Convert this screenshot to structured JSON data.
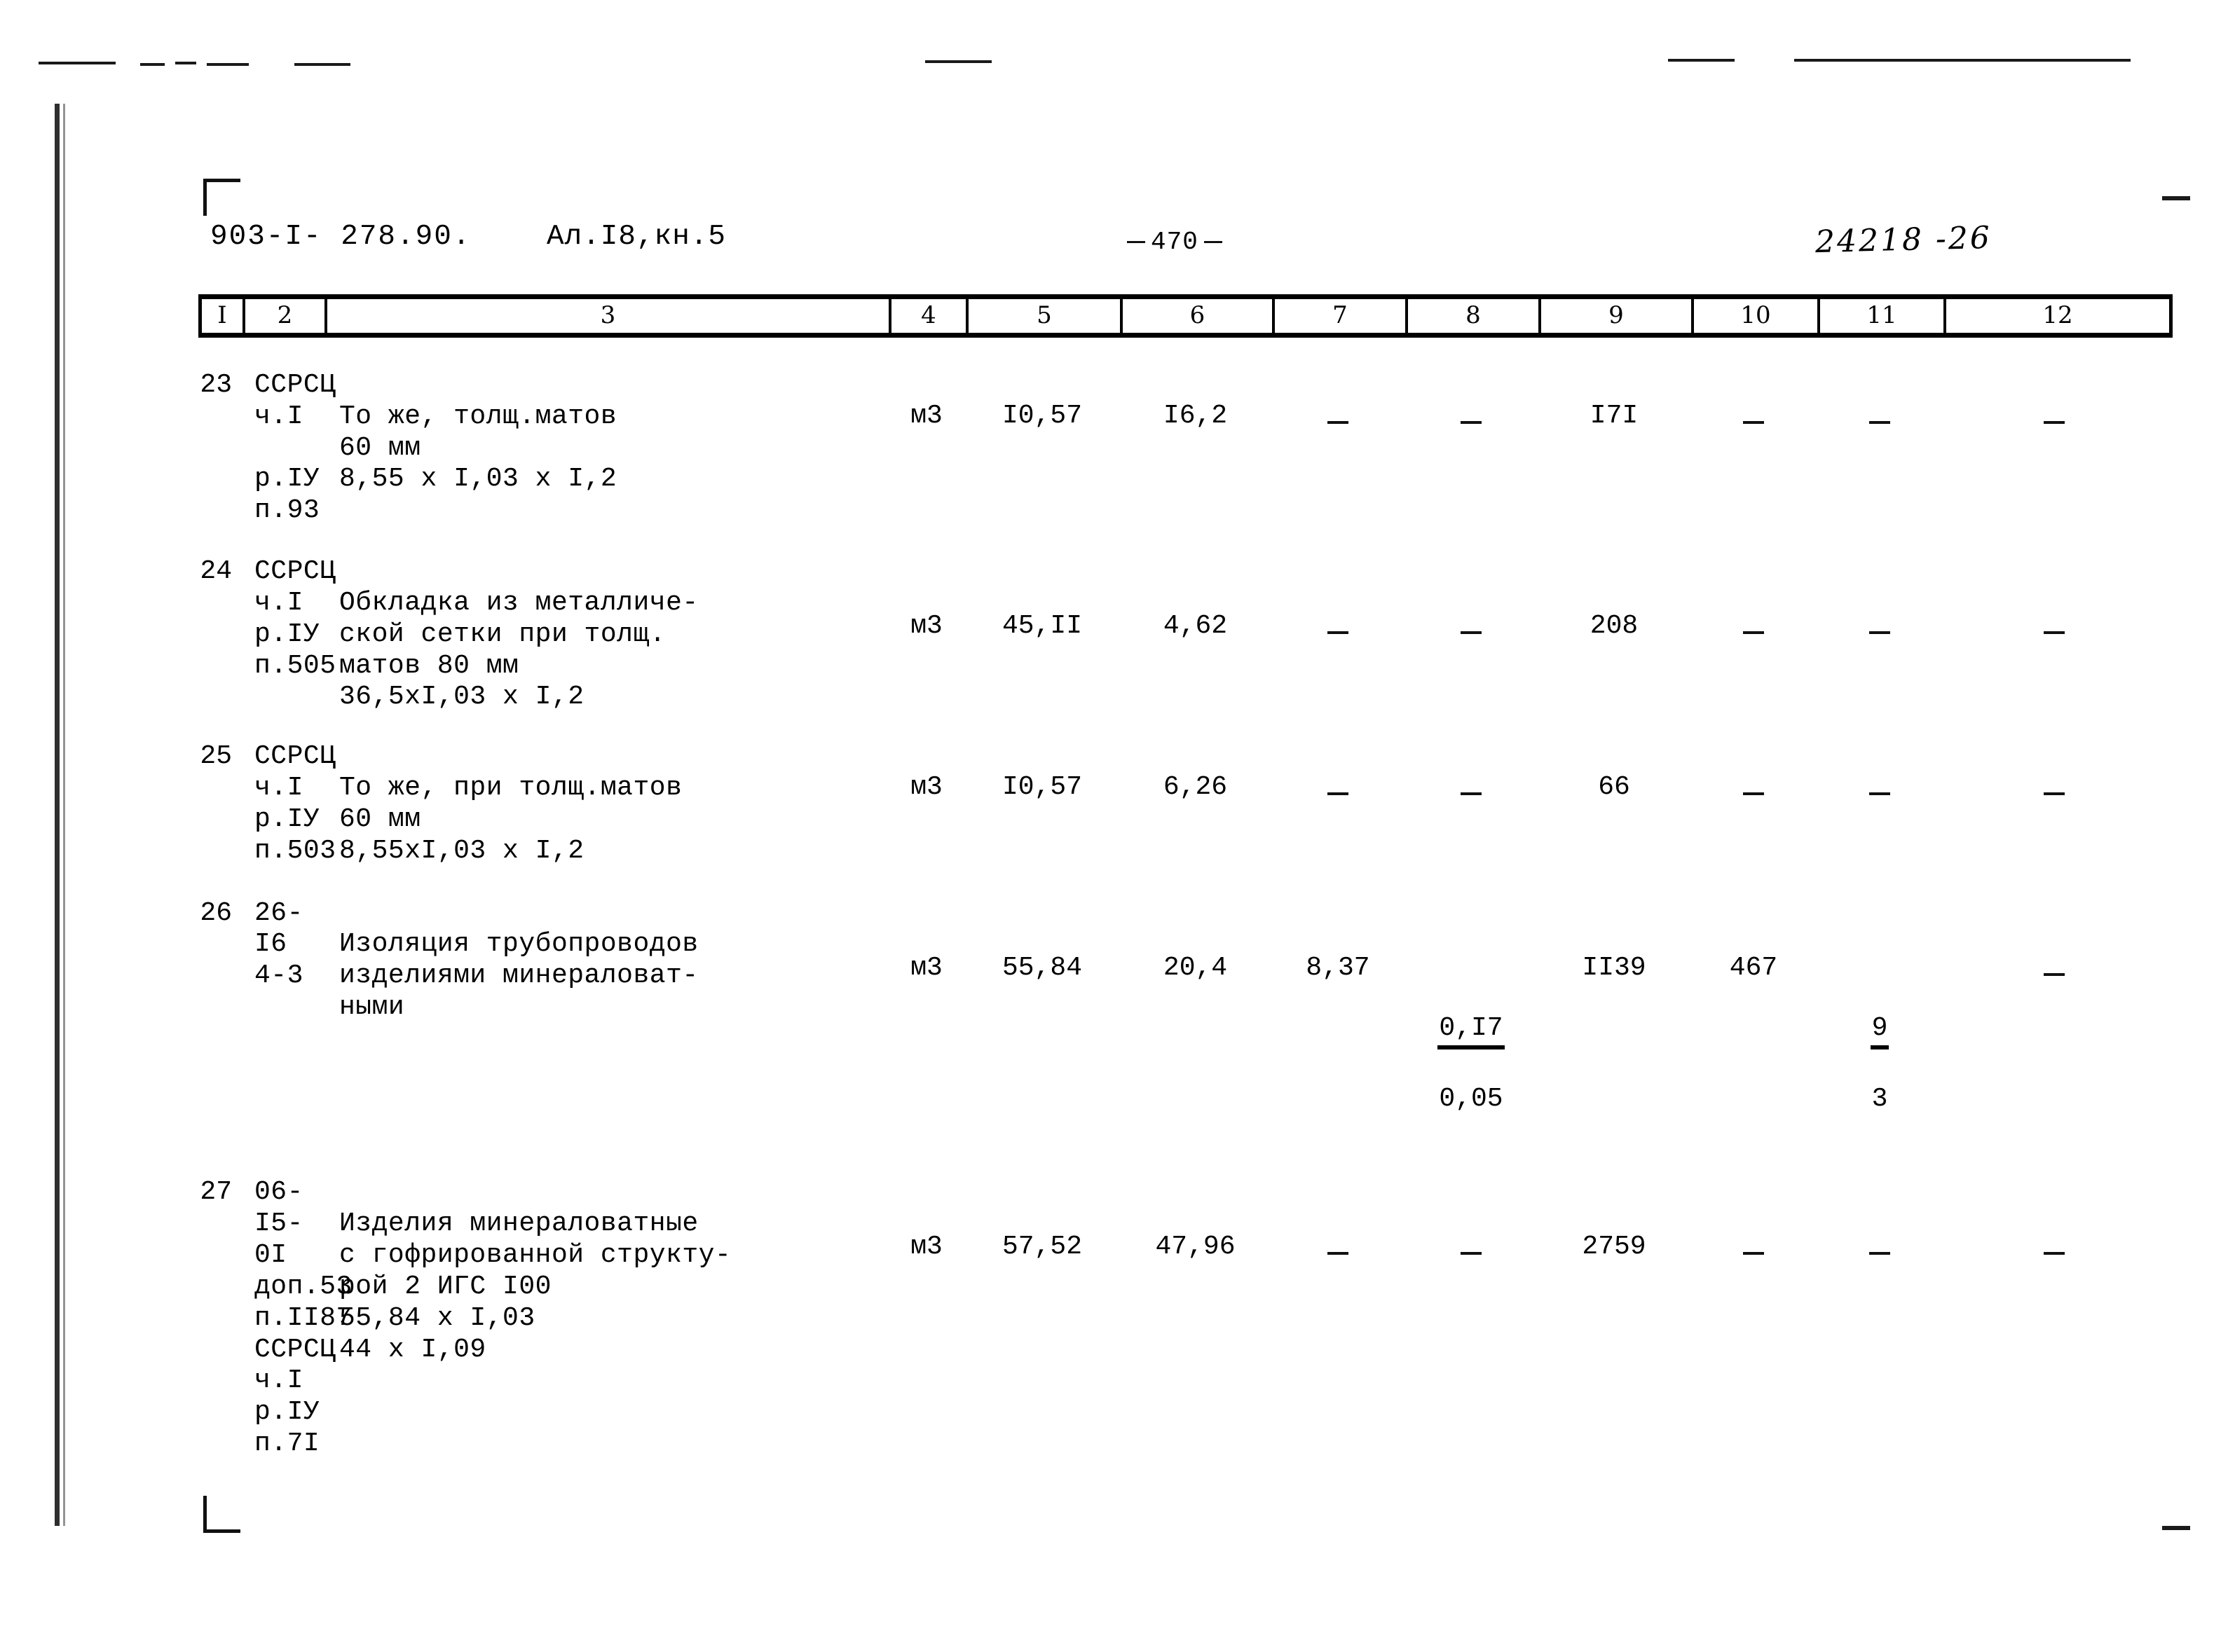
{
  "header": {
    "doc_code": "903-I- 278.90.",
    "album_code": "Ал.I8,кн.5",
    "page_number": "470",
    "stamp_number": "24218 -26"
  },
  "table": {
    "column_headers": [
      "I",
      "2",
      "3",
      "4",
      "5",
      "6",
      "7",
      "8",
      "9",
      "10",
      "11",
      "12"
    ],
    "rows": [
      {
        "index": "23",
        "code": "ССРСЦ\nч.I\n\nр.IУ\nп.93",
        "description": "То же, толщ.матов\n60 мм",
        "formula": "8,55 х I,03 х I,2",
        "unit": "м3",
        "col5": "I0,57",
        "col6": "I6,2",
        "col7": "–",
        "col8": "–",
        "col9": "I7I",
        "col10": "–",
        "col11": "–",
        "col12": "–"
      },
      {
        "index": "24",
        "code": "ССРСЦ\nч.I\nр.IУ\nп.505",
        "description": "Обкладка из металличе-\nской сетки при толщ.\nматов 80 мм",
        "formula": "36,5хI,03 х I,2",
        "unit": "м3",
        "col5": "45,II",
        "col6": "4,62",
        "col7": "–",
        "col8": "–",
        "col9": "208",
        "col10": "–",
        "col11": "–",
        "col12": "–"
      },
      {
        "index": "25",
        "code": "ССРСЦ\nч.I\nр.IУ\nп.503",
        "description": "То же, при толщ.матов\n60 мм",
        "formula": "8,55хI,03 х I,2",
        "unit": "м3",
        "col5": "I0,57",
        "col6": "6,26",
        "col7": "–",
        "col8": "–",
        "col9": "66",
        "col10": "–",
        "col11": "–",
        "col12": "–"
      },
      {
        "index": "26",
        "code": "26-I6\n4-3",
        "description": "Изоляция трубопроводов\nизделиями минераловат-\nными",
        "formula": "",
        "unit": "м3",
        "col5": "55,84",
        "col6": "20,4",
        "col7": "8,37",
        "col8_fraction": {
          "numerator": "0,I7",
          "denominator": "0,05"
        },
        "col9": "II39",
        "col10": "467",
        "col11_fraction": {
          "numerator": "9",
          "denominator": "3"
        },
        "col12": "–"
      },
      {
        "index": "27",
        "code": "06-I5-0I\nдоп.53\nп.II87\nССРСЦ\nч.I\nр.IУ\nп.7I",
        "description": "Изделия минераловатные\nс гофрированной структу-\nрой 2 ИГС I00",
        "formula": "55,84 х I,03",
        "formula2": "   44 х I,09",
        "unit": "м3",
        "col5": "57,52",
        "col6": "47,96",
        "col7": "–",
        "col8": "–",
        "col9": "2759",
        "col10": "–",
        "col11": "–",
        "col12": "–"
      }
    ]
  }
}
